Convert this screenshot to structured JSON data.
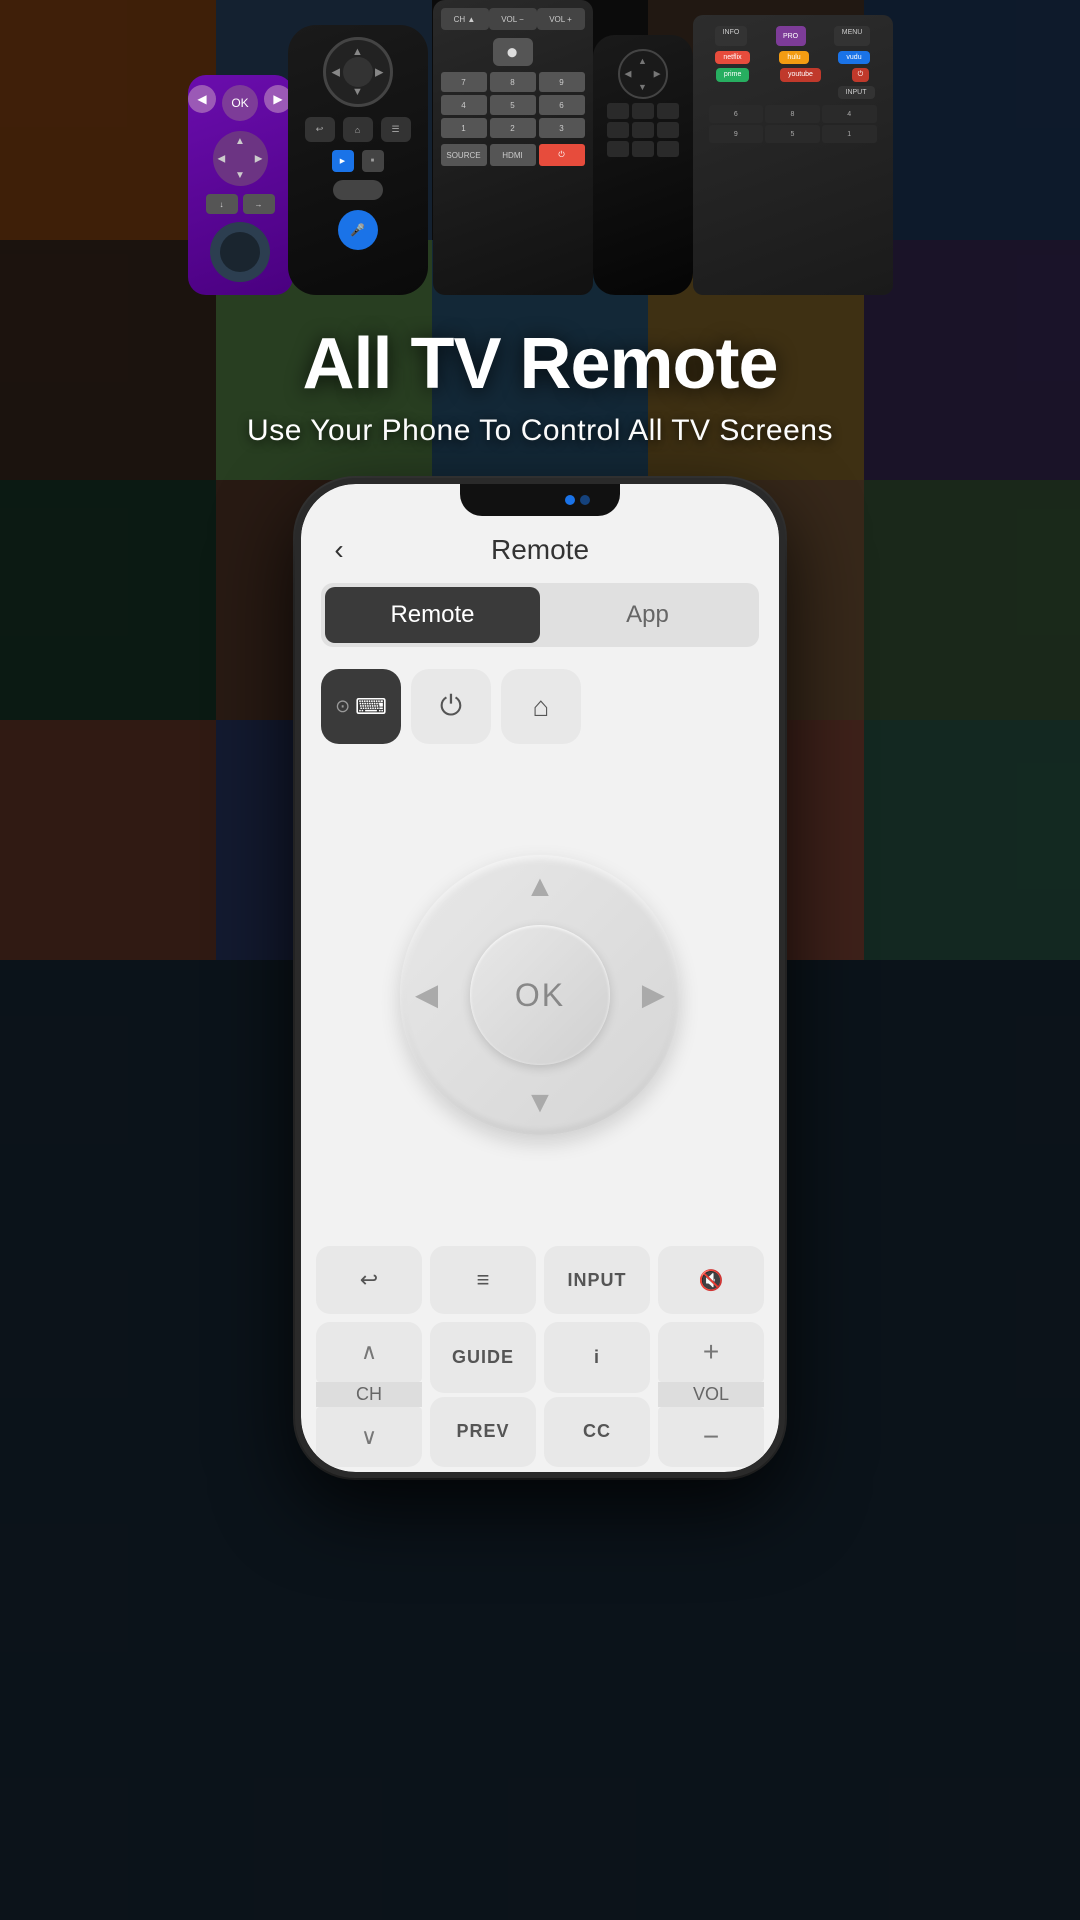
{
  "app": {
    "title": "All TV Remote",
    "subtitle": "Use Your Phone To Control All TV Screens"
  },
  "phone": {
    "nav": {
      "back_label": "‹",
      "title": "Remote"
    },
    "tabs": [
      {
        "id": "remote",
        "label": "Remote",
        "active": true
      },
      {
        "id": "app",
        "label": "App",
        "active": false
      }
    ],
    "quick_actions": [
      {
        "id": "touchpad",
        "icon": "⊙",
        "icon2": "⌨"
      },
      {
        "id": "power",
        "icon": "⏻"
      },
      {
        "id": "home",
        "icon": "⌂"
      }
    ],
    "dpad": {
      "ok_label": "OK",
      "up": "▲",
      "down": "▼",
      "left": "◀",
      "right": "▶"
    },
    "bottom_row1": [
      {
        "id": "back",
        "icon": "↩"
      },
      {
        "id": "menu",
        "icon": "≡"
      },
      {
        "id": "input",
        "label": "INPUT"
      },
      {
        "id": "mute",
        "icon": "🔇"
      }
    ],
    "ch_vol": {
      "ch_up": "∧",
      "ch_label": "CH",
      "ch_down": "∨",
      "guide": "GUIDE",
      "info": "i",
      "prev": "PREV",
      "cc": "CC",
      "vol_up": "+",
      "vol_label": "VOL",
      "vol_down": "−"
    }
  },
  "colors": {
    "accent": "#3a3a3a",
    "tab_active_bg": "#3a3a3a",
    "tab_active_text": "#ffffff",
    "tab_inactive_text": "#666666",
    "button_bg": "#e8e8e8",
    "dpad_bg": "#d5d5d5",
    "title_color": "#ffffff",
    "subtitle_color": "#ffffff"
  }
}
